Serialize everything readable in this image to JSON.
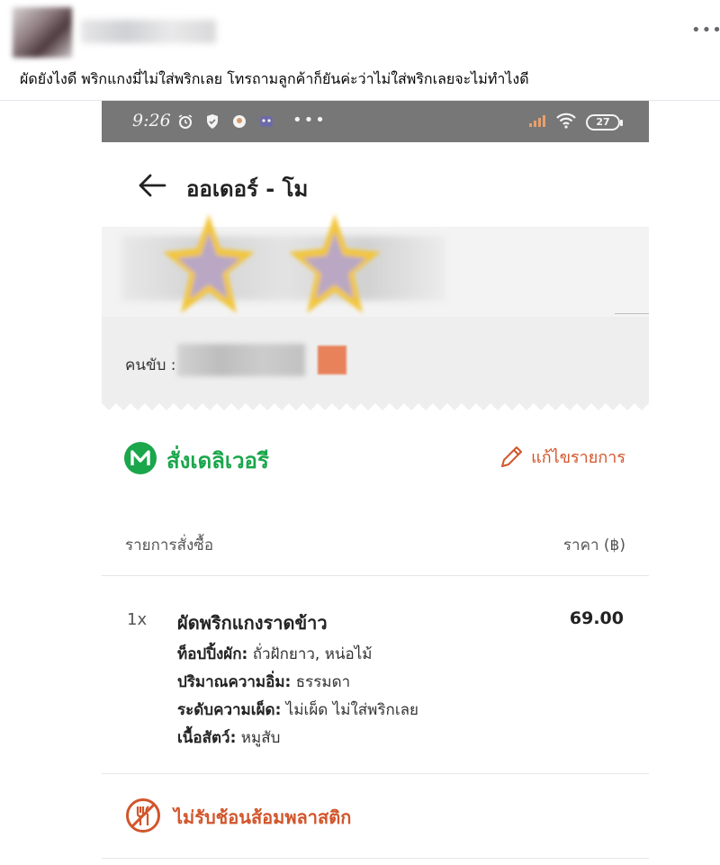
{
  "post": {
    "text": "ผัดยังไงดี  พริกแกงมี่ไม่ใส่พริกเลย  โทรถามลูกค้าก็ยันค่ะว่าไม่ใส่พริกเลยจะไม่ทำไงดี"
  },
  "status_bar": {
    "time": "9:26",
    "dots": "•••",
    "battery": "27"
  },
  "header": {
    "title": "ออเดอร์ - โม"
  },
  "driver": {
    "label": "คนขับ :"
  },
  "delivery": {
    "label": "สั่งเดลิเวอรี",
    "edit_label": "แก้ไขรายการ"
  },
  "order_list": {
    "header_left": "รายการสั่งซื้อ",
    "header_right": "ราคา (฿)",
    "items": [
      {
        "qty": "1x",
        "name": "ผัดพริกแกงราดข้าว",
        "price": "69.00",
        "options": [
          {
            "key": "ท็อปปิ้งผัก:",
            "value": " ถั่วฝักยาว, หน่อไม้"
          },
          {
            "key": "ปริมาณความอิ่ม:",
            "value": " ธรรมดา"
          },
          {
            "key": "ระดับความเผ็ด:",
            "value": " ไม่เผ็ด ไม่ใส่พริกเลย"
          },
          {
            "key": "เนื้อสัตว์:",
            "value": " หมูสับ"
          }
        ]
      }
    ]
  },
  "cutlery": {
    "label": "ไม่รับช้อนส้อมพลาสติก"
  },
  "colors": {
    "accent_orange": "#d2552b",
    "brand_green": "#1aa64b",
    "status_bar": "#777777"
  },
  "icons": [
    "more-icon",
    "alarm-icon",
    "shield-icon",
    "face-icon",
    "game-icon",
    "signal-icon",
    "wifi-icon",
    "battery-icon",
    "back-arrow-icon",
    "m-logo-icon",
    "pencil-icon",
    "no-cutlery-icon"
  ]
}
